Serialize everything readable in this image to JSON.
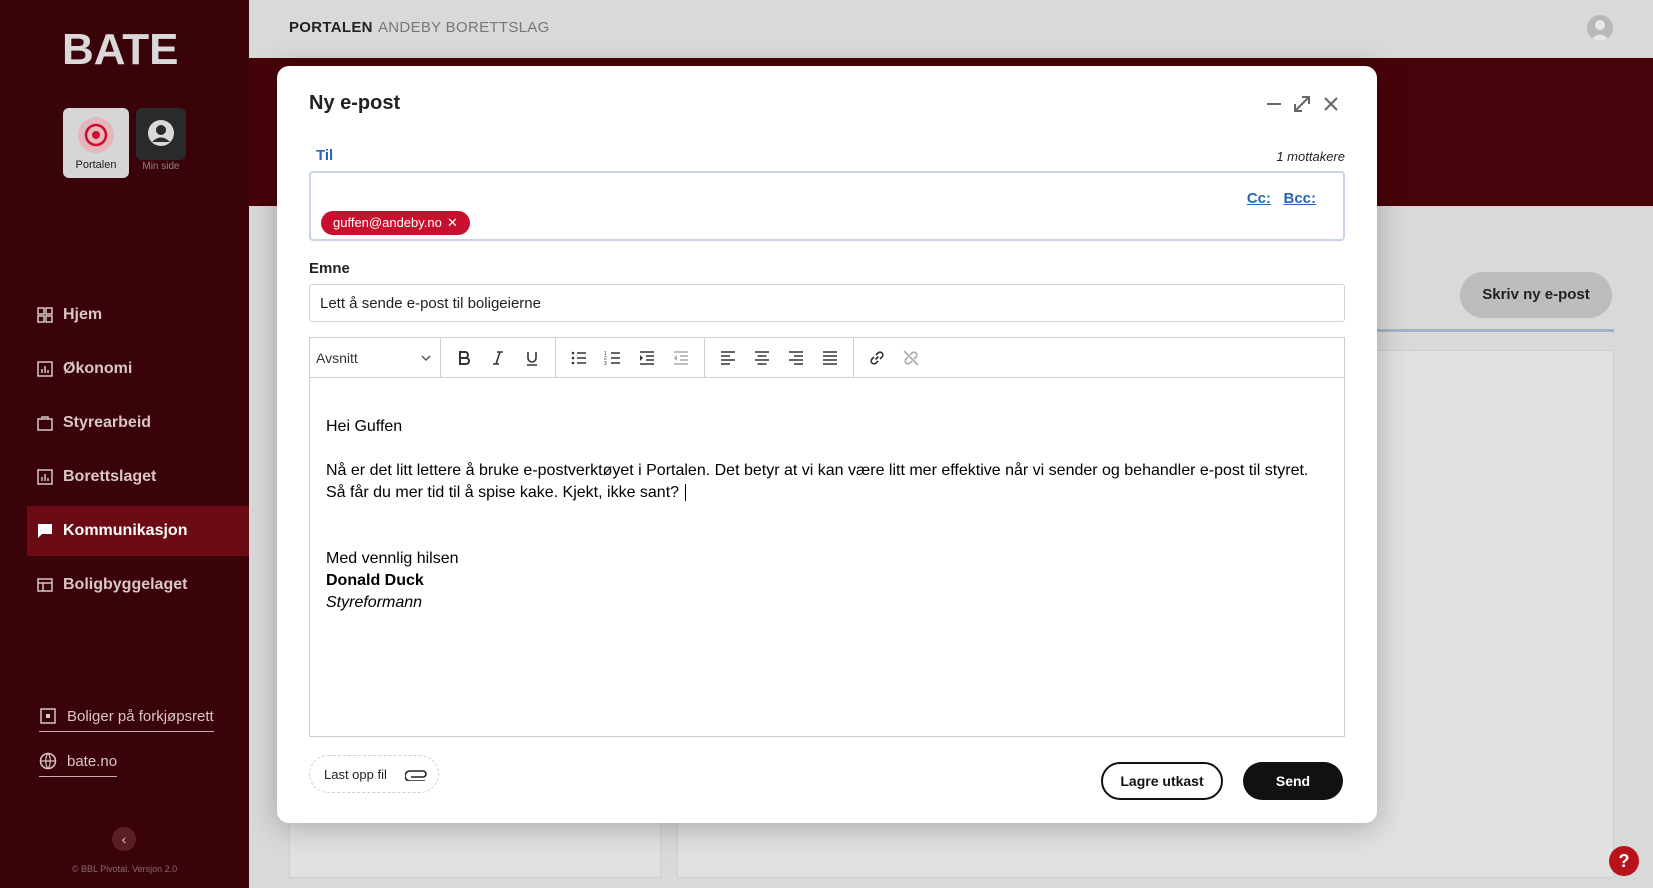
{
  "sidebar": {
    "logo_text": "BATE",
    "apps": [
      {
        "label": "Portalen",
        "icon": "portal-icon"
      },
      {
        "label": "Min side",
        "icon": "user-circle-icon"
      }
    ],
    "nav": [
      {
        "label": "Hjem",
        "icon": "grid-icon"
      },
      {
        "label": "Økonomi",
        "icon": "chart-icon"
      },
      {
        "label": "Styrearbeid",
        "icon": "briefcase-icon"
      },
      {
        "label": "Borettslaget",
        "icon": "chart-icon"
      },
      {
        "label": "Kommunikasjon",
        "icon": "chat-icon",
        "active": true
      },
      {
        "label": "Boligbyggelaget",
        "icon": "building-icon"
      }
    ],
    "bottom_links": [
      {
        "label": "Boliger på forkjøpsrett",
        "icon": "house-icon"
      },
      {
        "label": "bate.no",
        "icon": "globe-icon"
      }
    ],
    "collapse_icon": "chevron-left-icon",
    "copyright": "© BBL Pivotal. Versjon 2.0"
  },
  "header": {
    "breadcrumb_primary": "PORTALEN",
    "breadcrumb_secondary": "ANDEBY BORETTSLAG"
  },
  "page": {
    "write_button": "Skriv ny e-post",
    "help": "?"
  },
  "modal": {
    "title": "Ny e-post",
    "to_label": "Til",
    "recipient_count": "1 mottakere",
    "cc_label": "Cc:",
    "bcc_label": "Bcc:",
    "recipients": [
      "guffen@andeby.no"
    ],
    "subject_label": "Emne",
    "subject_value": "Lett å sende e-post til boligeierne",
    "format_select": "Avsnitt",
    "body": {
      "greeting": "Hei Guffen",
      "line1": "Nå er det litt lettere å bruke e-postverktøyet i Portalen. Det betyr at vi kan være litt mer effektive når vi sender og behandler e-post til styret.",
      "line2": "Så får du mer tid til å spise kake. Kjekt, ikke sant?",
      "closing": "Med vennlig hilsen",
      "sig_name": "Donald Duck",
      "sig_title": "Styreformann"
    },
    "upload_label": "Last opp fil",
    "draft_button": "Lagre utkast",
    "send_button": "Send"
  },
  "colors": {
    "sidebar_bg": "#3a0309",
    "banner_bg": "#470309",
    "chip_bg": "#c8102e",
    "link": "#2b63b5",
    "send_bg": "#111111"
  }
}
